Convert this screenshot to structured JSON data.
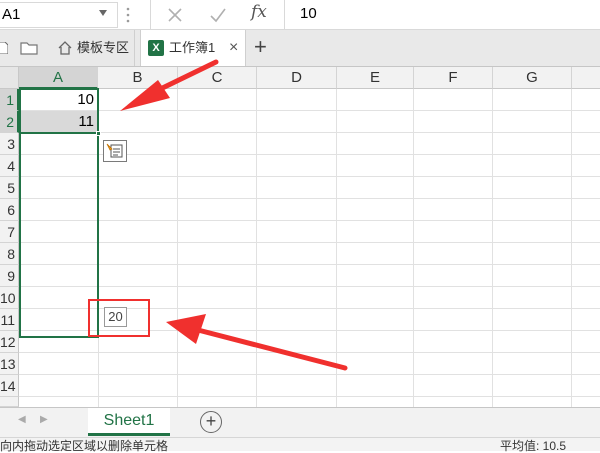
{
  "formula_bar": {
    "name_box": "A1",
    "cancel_icon": "x-icon",
    "enter_icon": "check-icon",
    "function_label": "fx",
    "value": "10"
  },
  "tabs": {
    "template_label": "模板专区",
    "workbook_label": "工作簿1",
    "workbook_badge": "X",
    "close_glyph": "×",
    "add_glyph": "+"
  },
  "grid": {
    "columns": [
      "A",
      "B",
      "C",
      "D",
      "E",
      "F",
      "G"
    ],
    "rows": [
      "1",
      "2",
      "3",
      "4",
      "5",
      "6",
      "7",
      "8",
      "9",
      "10",
      "11",
      "12",
      "13",
      "14"
    ],
    "cells": {
      "A1": "10",
      "A2": "11"
    },
    "fill_tooltip": "20"
  },
  "sheets": {
    "tabs": [
      "Sheet1"
    ],
    "add_glyph": "+"
  },
  "status_bar": {
    "message": "向内拖动选定区域以删除单元格",
    "average": "平均值: 10.5"
  },
  "colors": {
    "accent_green": "#217346",
    "annotation_red": "#f0302e"
  }
}
